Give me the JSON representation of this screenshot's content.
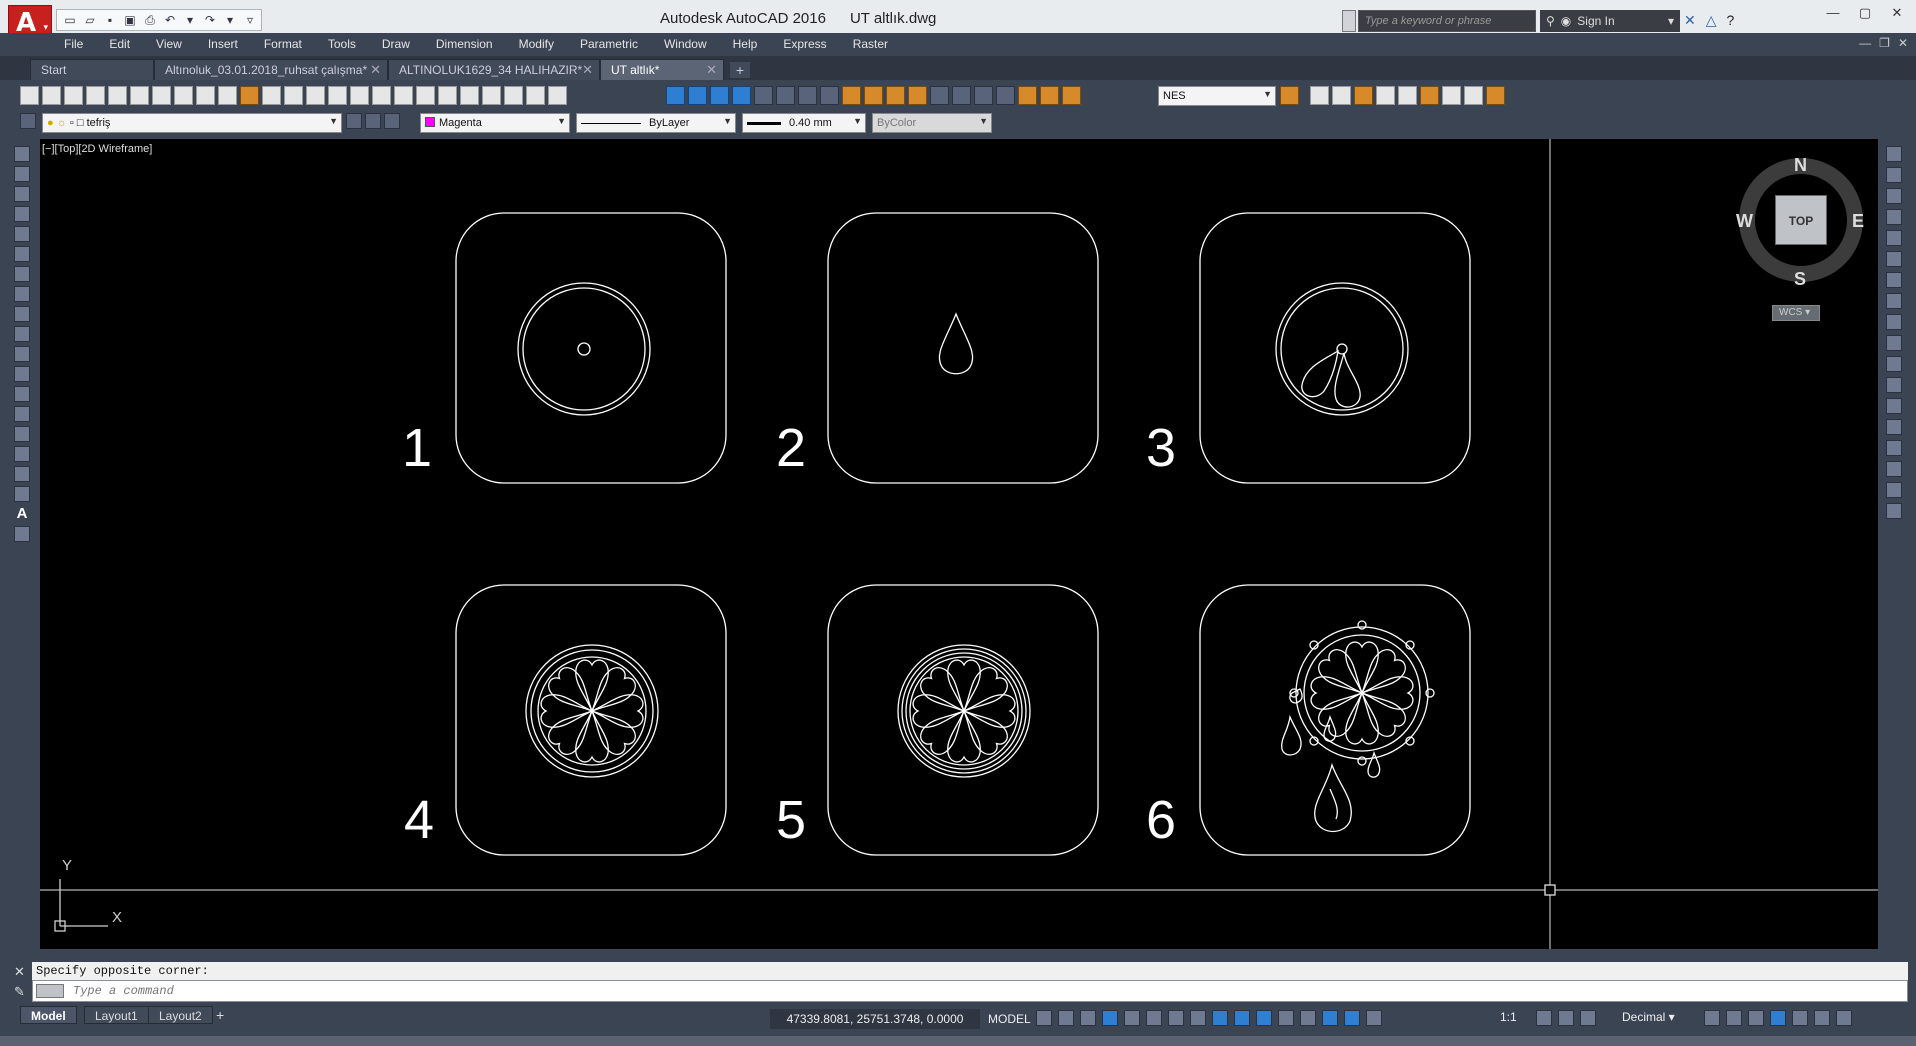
{
  "window": {
    "app_title": "Autodesk AutoCAD 2016",
    "file_title": "UT altlık.dwg",
    "search_placeholder": "Type a keyword or phrase",
    "sign_in": "Sign In"
  },
  "menu": [
    "File",
    "Edit",
    "View",
    "Insert",
    "Format",
    "Tools",
    "Draw",
    "Dimension",
    "Modify",
    "Parametric",
    "Window",
    "Help",
    "Express",
    "Raster"
  ],
  "tabs": [
    {
      "label": "Start",
      "active": false
    },
    {
      "label": "Altınoluk_03.01.2018_ruhsat çalışma*",
      "active": false
    },
    {
      "label": "ALTINOLUK1629_34 HALIHAZIR*",
      "active": false
    },
    {
      "label": "UT altlık*",
      "active": true
    }
  ],
  "toolbar": {
    "text_style": "NES",
    "layer": "tefriş",
    "color": "Magenta",
    "linetype": "ByLayer",
    "lineweight": "0.40 mm",
    "plotstyle": "ByColor"
  },
  "canvas": {
    "viewport_label": "[−][Top][2D Wireframe]",
    "panel_numbers": [
      "1",
      "2",
      "3",
      "4",
      "5",
      "6"
    ],
    "ucs_x": "X",
    "ucs_y": "Y"
  },
  "viewcube": {
    "north": "N",
    "south": "S",
    "east": "E",
    "west": "W",
    "top": "TOP",
    "wcs": "WCS"
  },
  "command": {
    "history": "Specify opposite corner:",
    "placeholder": "Type a command"
  },
  "status": {
    "layouts": [
      "Model",
      "Layout1",
      "Layout2"
    ],
    "coordinates": "47339.8081, 25751.3748, 0.0000",
    "space": "MODEL",
    "scale": "1:1",
    "units": "Decimal"
  },
  "colors": {
    "accent": "#c81f1f",
    "canvas": "#000000",
    "chrome": "#3b4453",
    "layer_swatch": "#ff00ff"
  }
}
